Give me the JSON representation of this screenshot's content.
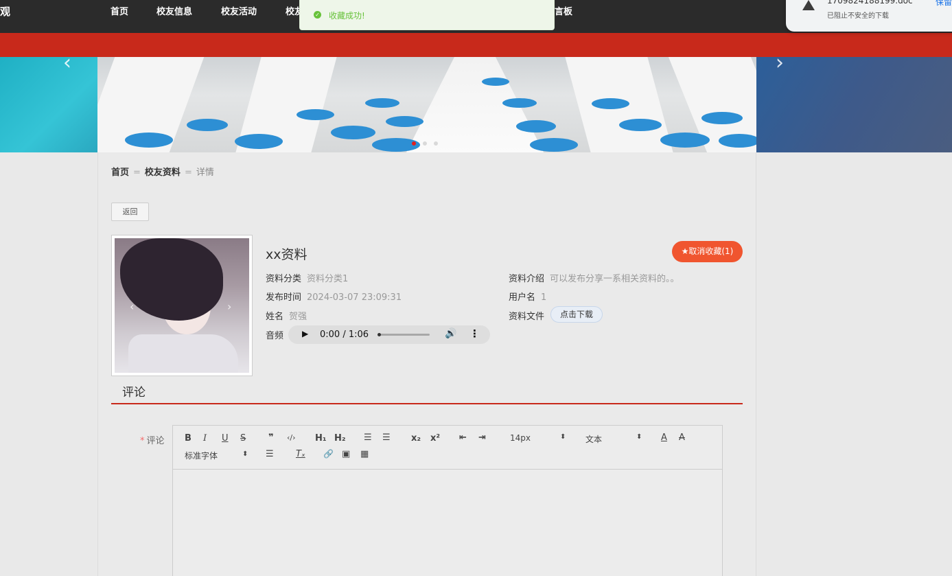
{
  "nav": {
    "brand_fragment": "观",
    "items": [
      "首页",
      "校友信息",
      "校友活动",
      "校友",
      "言板"
    ]
  },
  "toast": {
    "message": "收藏成功!"
  },
  "download": {
    "filename": "1709824188199.doc",
    "blocked": "已阻止不安全的下载",
    "keep": "保留"
  },
  "banner": {
    "dots": 3,
    "active_dot": 1
  },
  "breadcrumb": {
    "home": "首页",
    "section": "校友资料",
    "current": "详情",
    "sep": "="
  },
  "back_label": "返回",
  "detail": {
    "title": "xx资料",
    "favorite_label": "★取消收藏(1)",
    "category_label": "资料分类",
    "category_value": "资料分类1",
    "intro_label": "资料介绍",
    "intro_value": "可以发布分享一系相关资料的。。",
    "date_label": "发布时间",
    "date_value": "2024-03-07 23:09:31",
    "username_label": "用户名",
    "username_value": "1",
    "name_label": "姓名",
    "name_value": "贺强",
    "file_label": "资料文件",
    "download_label": "点击下载",
    "audio_label": "音频",
    "audio_time": "0:00 / 1:06",
    "audio_progress": 0
  },
  "comment": {
    "heading": "评论",
    "field_label": "评论",
    "required_mark": "*"
  },
  "toolbar": {
    "bold": "B",
    "italic": "I",
    "underline": "U",
    "strike": "S",
    "quote": "❞",
    "code": "‹/›",
    "h1": "H₁",
    "h2": "H₂",
    "ordered": "☰",
    "bullet": "☰",
    "sub": "x₂",
    "sup": "x²",
    "outdent": "⇤",
    "indent": "⇥",
    "size": "14px",
    "format": "文本",
    "font": "标准字体",
    "align": "☰",
    "clear": "Tₓ",
    "link": "🔗",
    "image": "▣",
    "video": "▦"
  }
}
